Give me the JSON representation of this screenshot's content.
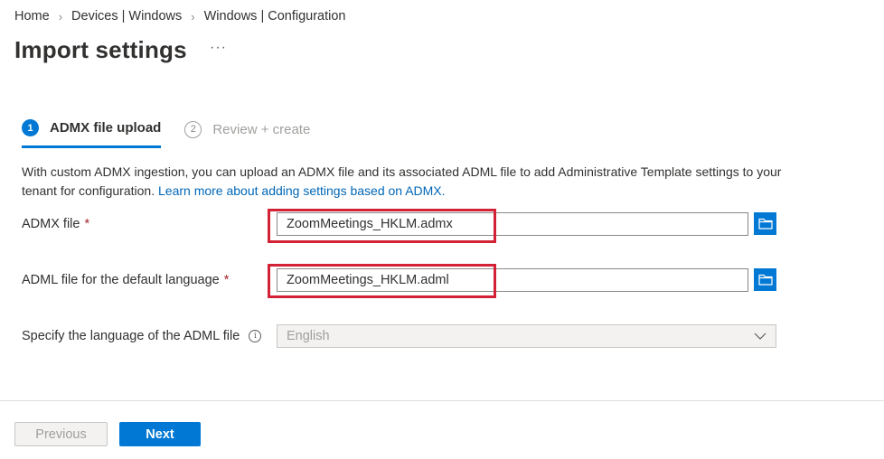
{
  "breadcrumb": [
    "Home",
    "Devices | Windows",
    "Windows | Configuration"
  ],
  "page": {
    "title": "Import settings",
    "more": "···"
  },
  "steps": [
    {
      "num": "1",
      "label": "ADMX file upload"
    },
    {
      "num": "2",
      "label": "Review + create"
    }
  ],
  "description": {
    "text": "With custom ADMX ingestion, you can upload an ADMX file and its associated ADML file to add Administrative Template settings to your tenant for configuration. ",
    "link": "Learn more about adding settings based on ADMX."
  },
  "form": {
    "admx": {
      "label": "ADMX file",
      "required": "*",
      "value": "ZoomMeetings_HKLM.admx"
    },
    "adml": {
      "label": "ADML file for the default language",
      "required": "*",
      "value": "ZoomMeetings_HKLM.adml"
    },
    "language": {
      "label": "Specify the language of the ADML file",
      "info": "i",
      "value": "English"
    }
  },
  "buttons": {
    "previous": "Previous",
    "next": "Next"
  },
  "colors": {
    "accent": "#0078d4",
    "highlight": "#d32235",
    "required": "#a4262c"
  }
}
